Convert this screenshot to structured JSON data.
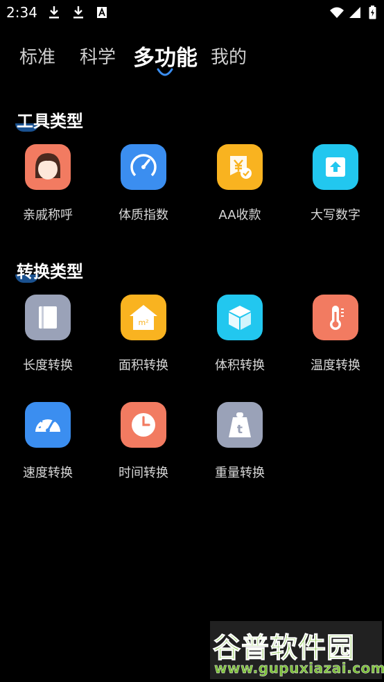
{
  "status_bar": {
    "time": "2:34",
    "icons": [
      "download-icon",
      "download-icon",
      "font-a-icon",
      "wifi-icon",
      "signal-icon",
      "battery-icon"
    ]
  },
  "tabs": [
    {
      "label": "标准",
      "active": false
    },
    {
      "label": "科学",
      "active": false
    },
    {
      "label": "多功能",
      "active": true
    },
    {
      "label": "我的",
      "active": false
    }
  ],
  "sections": [
    {
      "title": "工具类型",
      "items": [
        {
          "label": "亲戚称呼",
          "icon": "girl-face-icon",
          "color": "#f27b61"
        },
        {
          "label": "体质指数",
          "icon": "gauge-icon",
          "color": "#3b8ef0"
        },
        {
          "label": "AA收款",
          "icon": "yen-receipt-icon",
          "color": "#f9b320"
        },
        {
          "label": "大写数字",
          "icon": "upload-arrow-icon",
          "color": "#22c7ef"
        }
      ]
    },
    {
      "title": "转换类型",
      "items": [
        {
          "label": "长度转换",
          "icon": "book-icon",
          "color": "#9aa2b8"
        },
        {
          "label": "面积转换",
          "icon": "house-m2-icon",
          "color": "#f9b320"
        },
        {
          "label": "体积转换",
          "icon": "cube-icon",
          "color": "#22c7ef"
        },
        {
          "label": "温度转换",
          "icon": "thermometer-icon",
          "color": "#f27b61"
        },
        {
          "label": "速度转换",
          "icon": "speedometer-icon",
          "color": "#3b8ef0"
        },
        {
          "label": "时间转换",
          "icon": "clock-icon",
          "color": "#f27b61"
        },
        {
          "label": "重量转换",
          "icon": "weight-icon",
          "color": "#9aa2b8"
        }
      ]
    }
  ],
  "watermark": {
    "title": "谷普软件园",
    "url": "www.gupuxiazai.com"
  }
}
